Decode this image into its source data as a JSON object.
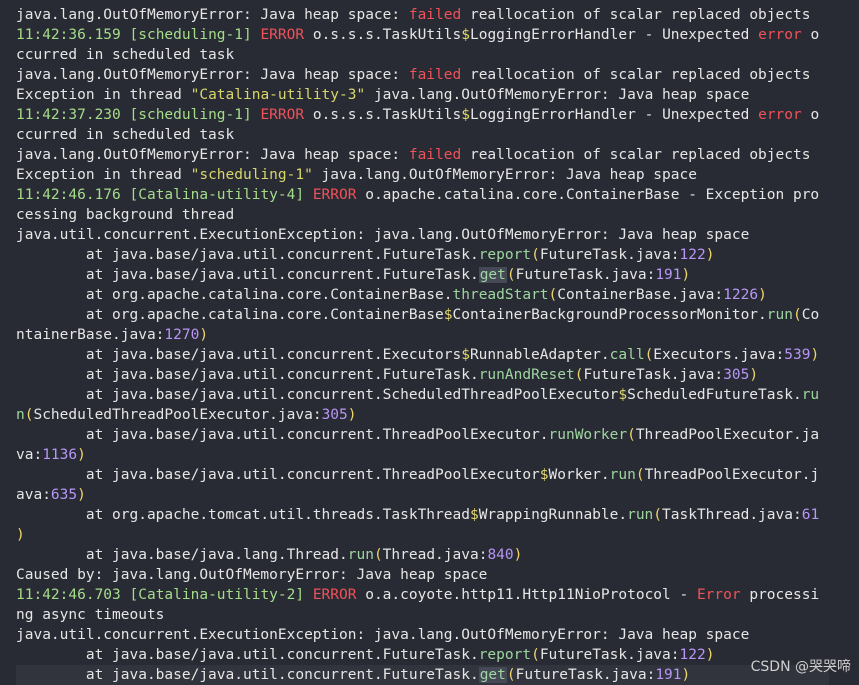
{
  "colors": {
    "background": "#282b33",
    "text": "#e6e6e6",
    "timestamp": "#a5dc8a",
    "error": "#f0525a",
    "string": "#d9d66a",
    "number": "#b896f5",
    "symbol": "#e3d86e",
    "wrap_indicator": "#6d8dd6"
  },
  "lines": [
    {
      "wrap": false,
      "hl": false,
      "segs": [
        [
          "java.lang.OutOfMemoryError: Java heap space: ",
          ""
        ],
        [
          "failed",
          "red"
        ],
        [
          " reallocation of scalar replaced objects",
          ""
        ]
      ]
    },
    {
      "wrap": true,
      "hl": false,
      "segs": [
        [
          "11:42:36.159 ",
          "time"
        ],
        [
          "[scheduling-1] ",
          "thread"
        ],
        [
          "ERROR",
          "red"
        ],
        [
          " o.s.s.s.TaskUtils",
          ""
        ],
        [
          "$",
          "sym"
        ],
        [
          "LoggingErrorHandler ",
          ""
        ],
        [
          "- ",
          ""
        ],
        [
          "Unexpected ",
          ""
        ],
        [
          "error",
          "red"
        ],
        [
          " o",
          ""
        ]
      ]
    },
    {
      "wrap": false,
      "hl": false,
      "segs": [
        [
          "ccurred in scheduled task",
          ""
        ]
      ]
    },
    {
      "wrap": false,
      "hl": false,
      "segs": [
        [
          "java.lang.OutOfMemoryError: Java heap space: ",
          ""
        ],
        [
          "failed",
          "red"
        ],
        [
          " reallocation of scalar replaced objects",
          ""
        ]
      ]
    },
    {
      "wrap": false,
      "hl": false,
      "segs": [
        [
          "Exception in thread ",
          ""
        ],
        [
          "\"Catalina-utility-3\"",
          "str"
        ],
        [
          " java.lang.OutOfMemoryError: Java heap space",
          ""
        ]
      ]
    },
    {
      "wrap": true,
      "hl": false,
      "segs": [
        [
          "11:42:37.230 ",
          "time"
        ],
        [
          "[scheduling-1] ",
          "thread"
        ],
        [
          "ERROR",
          "red"
        ],
        [
          " o.s.s.s.TaskUtils",
          ""
        ],
        [
          "$",
          "sym"
        ],
        [
          "LoggingErrorHandler ",
          ""
        ],
        [
          "- ",
          ""
        ],
        [
          "Unexpected ",
          ""
        ],
        [
          "error",
          "red"
        ],
        [
          " o",
          ""
        ]
      ]
    },
    {
      "wrap": false,
      "hl": false,
      "segs": [
        [
          "ccurred in scheduled task",
          ""
        ]
      ]
    },
    {
      "wrap": false,
      "hl": false,
      "segs": [
        [
          "java.lang.OutOfMemoryError: Java heap space: ",
          ""
        ],
        [
          "failed",
          "red"
        ],
        [
          " reallocation of scalar replaced objects",
          ""
        ]
      ]
    },
    {
      "wrap": false,
      "hl": false,
      "segs": [
        [
          "Exception in thread ",
          ""
        ],
        [
          "\"scheduling-1\"",
          "str"
        ],
        [
          " java.lang.OutOfMemoryError: Java heap space",
          ""
        ]
      ]
    },
    {
      "wrap": true,
      "hl": false,
      "segs": [
        [
          "11:42:46.176 ",
          "time"
        ],
        [
          "[Catalina-utility-4] ",
          "thread"
        ],
        [
          "ERROR",
          "red"
        ],
        [
          " o.apache.catalina.core.ContainerBase - Exception pro",
          ""
        ]
      ]
    },
    {
      "wrap": false,
      "hl": false,
      "segs": [
        [
          "cessing background thread",
          ""
        ]
      ]
    },
    {
      "wrap": false,
      "hl": false,
      "segs": [
        [
          "java.util.concurrent.ExecutionException: java.lang.OutOfMemoryError: Java heap space",
          ""
        ]
      ]
    },
    {
      "wrap": false,
      "hl": false,
      "segs": [
        [
          "        at java.base/java.util.concurrent.FutureTask.",
          ""
        ],
        [
          "report",
          "method"
        ],
        [
          "(",
          "par"
        ],
        [
          "FutureTask.java:",
          ""
        ],
        [
          "122",
          "num"
        ],
        [
          ")",
          "par"
        ]
      ]
    },
    {
      "wrap": false,
      "hl": false,
      "segs": [
        [
          "        at java.base/java.util.concurrent.FutureTask.",
          ""
        ],
        [
          "get",
          "gethl"
        ],
        [
          "(",
          "par"
        ],
        [
          "FutureTask.java:",
          ""
        ],
        [
          "191",
          "num"
        ],
        [
          ")",
          "par"
        ]
      ]
    },
    {
      "wrap": false,
      "hl": false,
      "segs": [
        [
          "        at org.apache.catalina.core.ContainerBase.",
          ""
        ],
        [
          "threadStart",
          "method"
        ],
        [
          "(",
          "par"
        ],
        [
          "ContainerBase.java:",
          ""
        ],
        [
          "1226",
          "num"
        ],
        [
          ")",
          "par"
        ]
      ]
    },
    {
      "wrap": true,
      "hl": false,
      "segs": [
        [
          "        at org.apache.catalina.core.ContainerBase",
          ""
        ],
        [
          "$",
          "sym"
        ],
        [
          "ContainerBackgroundProcessorMonitor.",
          ""
        ],
        [
          "run",
          "method"
        ],
        [
          "(",
          "par"
        ],
        [
          "Co",
          ""
        ]
      ]
    },
    {
      "wrap": false,
      "hl": false,
      "segs": [
        [
          "ntainerBase.java:",
          ""
        ],
        [
          "1270",
          "num"
        ],
        [
          ")",
          "par"
        ]
      ]
    },
    {
      "wrap": false,
      "hl": false,
      "segs": [
        [
          "        at java.base/java.util.concurrent.Executors",
          ""
        ],
        [
          "$",
          "sym"
        ],
        [
          "RunnableAdapter.",
          ""
        ],
        [
          "call",
          "method"
        ],
        [
          "(",
          "par"
        ],
        [
          "Executors.java:",
          ""
        ],
        [
          "539",
          "num"
        ],
        [
          ")",
          "par"
        ]
      ]
    },
    {
      "wrap": false,
      "hl": false,
      "segs": [
        [
          "        at java.base/java.util.concurrent.FutureTask.",
          ""
        ],
        [
          "runAndReset",
          "method"
        ],
        [
          "(",
          "par"
        ],
        [
          "FutureTask.java:",
          ""
        ],
        [
          "305",
          "num"
        ],
        [
          ")",
          "par"
        ]
      ]
    },
    {
      "wrap": true,
      "hl": false,
      "segs": [
        [
          "        at java.base/java.util.concurrent.ScheduledThreadPoolExecutor",
          ""
        ],
        [
          "$",
          "sym"
        ],
        [
          "ScheduledFutureTask.",
          ""
        ],
        [
          "ru",
          "method"
        ]
      ]
    },
    {
      "wrap": false,
      "hl": false,
      "segs": [
        [
          "n",
          "method"
        ],
        [
          "(",
          "par"
        ],
        [
          "ScheduledThreadPoolExecutor.java:",
          ""
        ],
        [
          "305",
          "num"
        ],
        [
          ")",
          "par"
        ]
      ]
    },
    {
      "wrap": true,
      "hl": false,
      "segs": [
        [
          "        at java.base/java.util.concurrent.ThreadPoolExecutor.",
          ""
        ],
        [
          "runWorker",
          "method"
        ],
        [
          "(",
          "par"
        ],
        [
          "ThreadPoolExecutor.ja",
          ""
        ]
      ]
    },
    {
      "wrap": false,
      "hl": false,
      "segs": [
        [
          "va:",
          ""
        ],
        [
          "1136",
          "num"
        ],
        [
          ")",
          "par"
        ]
      ]
    },
    {
      "wrap": true,
      "hl": false,
      "segs": [
        [
          "        at java.base/java.util.concurrent.ThreadPoolExecutor",
          ""
        ],
        [
          "$",
          "sym"
        ],
        [
          "Worker.",
          ""
        ],
        [
          "run",
          "method"
        ],
        [
          "(",
          "par"
        ],
        [
          "ThreadPoolExecutor.j",
          ""
        ]
      ]
    },
    {
      "wrap": false,
      "hl": false,
      "segs": [
        [
          "ava:",
          ""
        ],
        [
          "635",
          "num"
        ],
        [
          ")",
          "par"
        ]
      ]
    },
    {
      "wrap": true,
      "hl": false,
      "segs": [
        [
          "        at org.apache.tomcat.util.threads.TaskThread",
          ""
        ],
        [
          "$",
          "sym"
        ],
        [
          "WrappingRunnable.",
          ""
        ],
        [
          "run",
          "method"
        ],
        [
          "(",
          "par"
        ],
        [
          "TaskThread.java:",
          ""
        ],
        [
          "61",
          "num"
        ]
      ]
    },
    {
      "wrap": false,
      "hl": false,
      "segs": [
        [
          ")",
          "par"
        ]
      ]
    },
    {
      "wrap": false,
      "hl": false,
      "segs": [
        [
          "        at java.base/java.lang.Thread.",
          ""
        ],
        [
          "run",
          "method"
        ],
        [
          "(",
          "par"
        ],
        [
          "Thread.java:",
          ""
        ],
        [
          "840",
          "num"
        ],
        [
          ")",
          "par"
        ]
      ]
    },
    {
      "wrap": false,
      "hl": false,
      "segs": [
        [
          "Caused by: java.lang.OutOfMemoryError: Java heap space",
          ""
        ]
      ]
    },
    {
      "wrap": true,
      "hl": false,
      "segs": [
        [
          "11:42:46.703 ",
          "time"
        ],
        [
          "[Catalina-utility-2] ",
          "thread"
        ],
        [
          "ERROR",
          "red"
        ],
        [
          " o.a.coyote.http11.Http11NioProtocol - ",
          ""
        ],
        [
          "Error",
          "red"
        ],
        [
          " processi",
          ""
        ]
      ]
    },
    {
      "wrap": false,
      "hl": false,
      "segs": [
        [
          "ng async timeouts",
          ""
        ]
      ]
    },
    {
      "wrap": false,
      "hl": false,
      "segs": [
        [
          "java.util.concurrent.ExecutionException: java.lang.OutOfMemoryError: Java heap space",
          ""
        ]
      ]
    },
    {
      "wrap": false,
      "hl": false,
      "segs": [
        [
          "        at java.base/java.util.concurrent.FutureTask.",
          ""
        ],
        [
          "report",
          "method"
        ],
        [
          "(",
          "par"
        ],
        [
          "FutureTask.java:",
          ""
        ],
        [
          "122",
          "num"
        ],
        [
          ")",
          "par"
        ]
      ]
    },
    {
      "wrap": false,
      "hl": true,
      "segs": [
        [
          "        at java.base/java.util.concurrent.FutureTask.",
          ""
        ],
        [
          "get",
          "gethl"
        ],
        [
          "(",
          "par"
        ],
        [
          "FutureTask.java:",
          ""
        ],
        [
          "191",
          "num"
        ],
        [
          ")",
          "par"
        ]
      ]
    }
  ],
  "watermark": "CSDN @哭哭啼"
}
